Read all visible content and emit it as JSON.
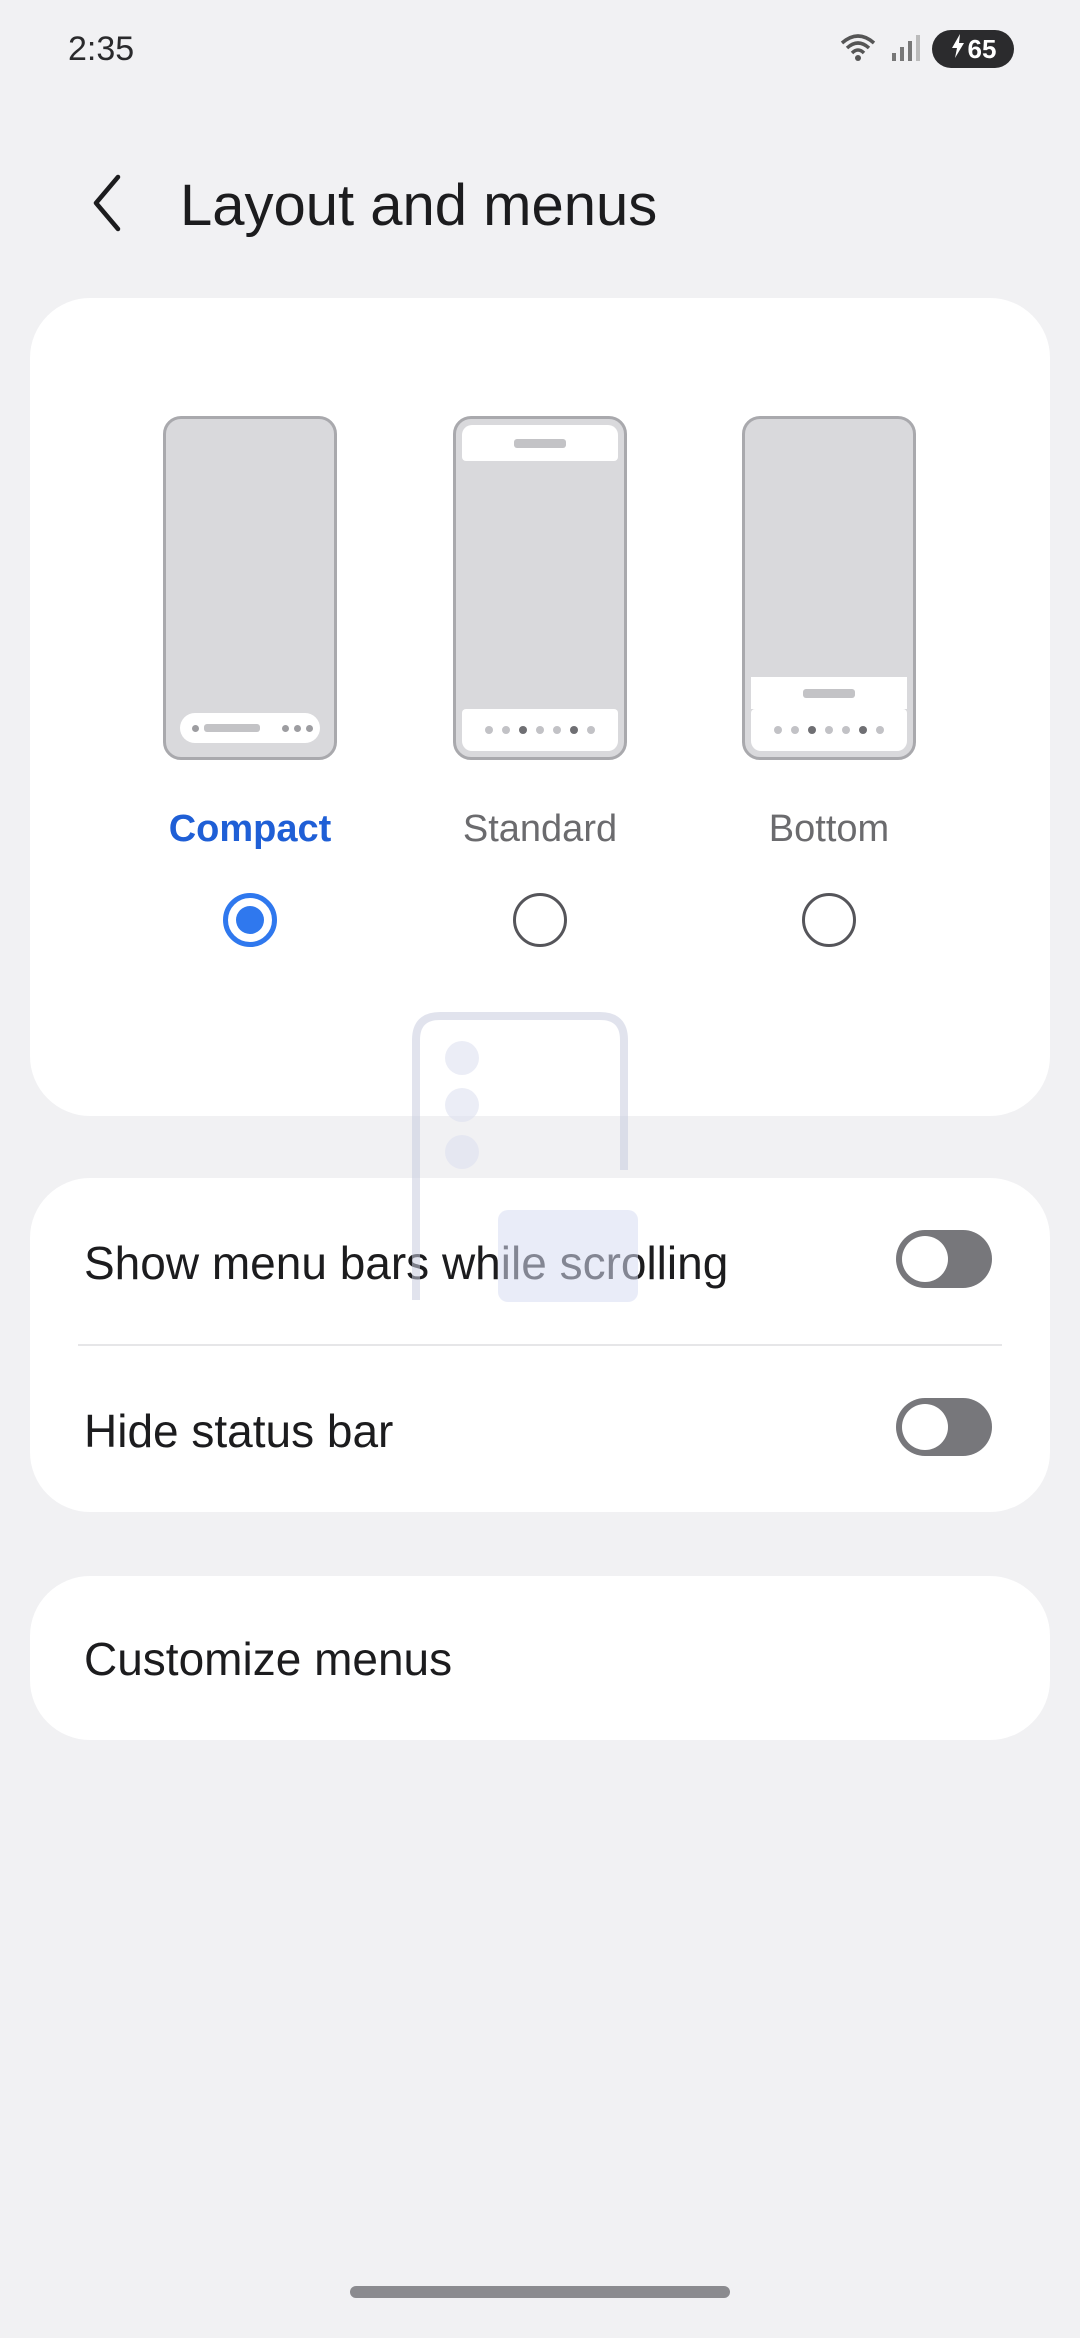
{
  "status_bar": {
    "time": "2:35",
    "battery": "65"
  },
  "header": {
    "title": "Layout and menus",
    "back_icon": "chevron-left-icon"
  },
  "layout_options": [
    {
      "label": "Compact",
      "selected": true
    },
    {
      "label": "Standard",
      "selected": false
    },
    {
      "label": "Bottom",
      "selected": false
    }
  ],
  "settings": {
    "show_menu_bars": {
      "label": "Show menu bars while scrolling",
      "enabled": false
    },
    "hide_status_bar": {
      "label": "Hide status bar",
      "enabled": false
    }
  },
  "customize": {
    "label": "Customize menus"
  },
  "colors": {
    "accent": "#2f78ee",
    "selected_label": "#1f5fd6",
    "background": "#f1f1f3",
    "card": "#ffffff"
  }
}
